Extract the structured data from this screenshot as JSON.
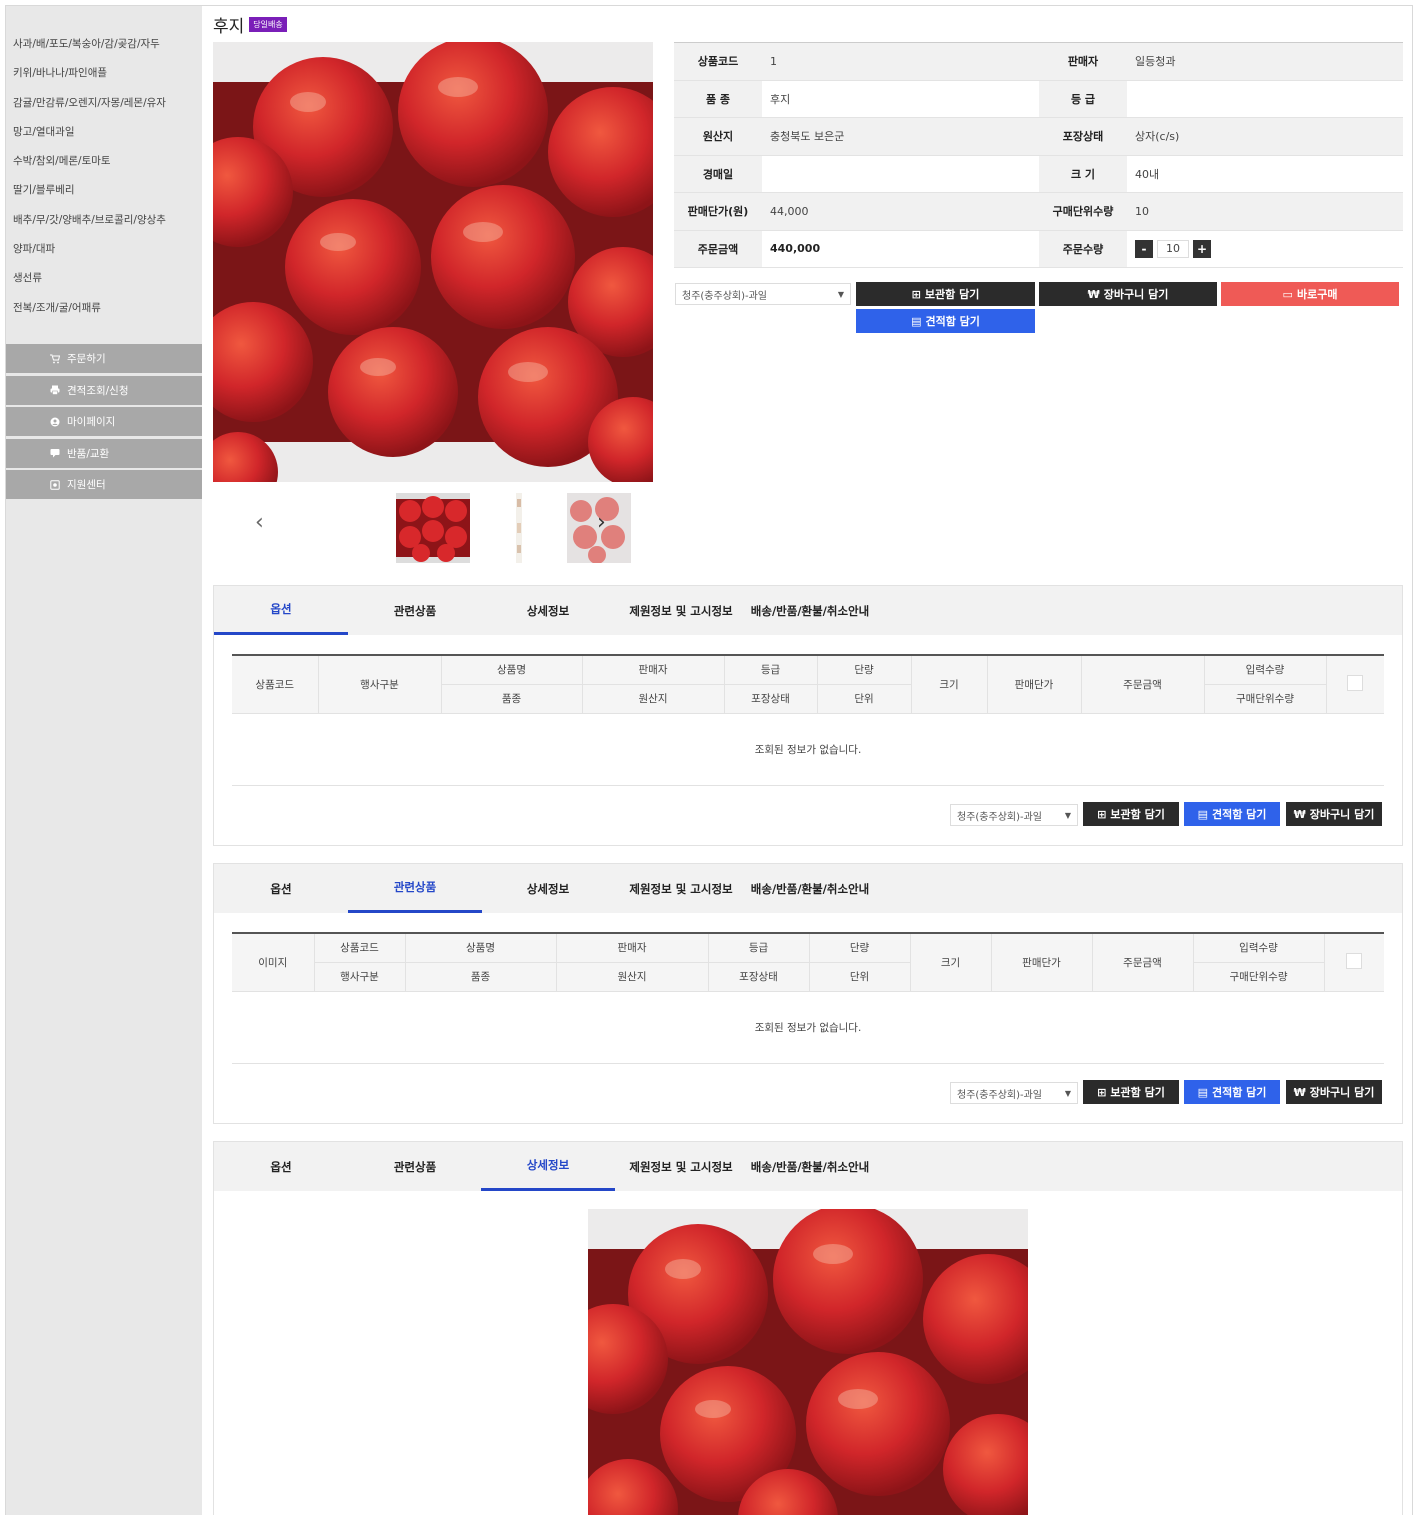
{
  "sidebar": {
    "categories": [
      "사과/배/포도/복숭아/감/곶감/자두",
      "키위/바나나/파인애플",
      "감귤/만감류/오렌지/자몽/레몬/유자",
      "망고/열대과일",
      "수박/참외/메론/토마토",
      "딸기/블루베리",
      "배추/무/갓/양배추/브로콜리/양상추",
      "양파/대파",
      "생선류",
      "전복/조개/굴/어패류"
    ],
    "menu": [
      {
        "label": "주문하기",
        "icon": "cart-icon"
      },
      {
        "label": "견적조회/신청",
        "icon": "print-icon"
      },
      {
        "label": "마이페이지",
        "icon": "user-icon"
      },
      {
        "label": "반품/교환",
        "icon": "chat-icon"
      },
      {
        "label": "지원센터",
        "icon": "support-icon"
      }
    ]
  },
  "product": {
    "title": "후지",
    "badge": "당일배송",
    "labels": {
      "code": "상품코드",
      "seller": "판매자",
      "variety": "품 종",
      "grade": "등 급",
      "origin": "원산지",
      "packaging": "포장상태",
      "auction_date": "경매일",
      "size": "크 기",
      "unit_price": "판매단가(원)",
      "unit_qty": "구매단위수량",
      "order_amount": "주문금액",
      "order_qty": "주문수량"
    },
    "values": {
      "code": "1",
      "seller": "일등청과",
      "variety": "후지",
      "grade": "",
      "origin": "충청북도 보은군",
      "packaging": "상자(c/s)",
      "auction_date": "",
      "size": "40내",
      "unit_price": "44,000",
      "unit_qty": "10",
      "order_amount": "440,000",
      "order_qty": "10"
    },
    "qty_minus": "-",
    "qty_plus": "+"
  },
  "actions": {
    "market_select": "청주(충주상회)-과일",
    "storage": "보관함 담기",
    "cart": "장바구니 담기",
    "buy_now": "바로구매",
    "estimate": "견적함 담기"
  },
  "tabs": [
    "옵션",
    "관련상품",
    "상세정보",
    "제원정보 및 고시정보",
    "배송/반품/환불/취소안내"
  ],
  "option_table": {
    "top": [
      "상품명",
      "판매자",
      "등급",
      "단량",
      "입력수량"
    ],
    "bottom": [
      "품종",
      "원산지",
      "포장상태",
      "단위",
      "구매단위수량"
    ],
    "span": [
      "상품코드",
      "행사구분",
      "크기",
      "판매단가",
      "주문금액"
    ],
    "empty": "조회된 정보가 없습니다."
  },
  "related_table": {
    "image": "이미지",
    "top": [
      "상품코드",
      "상품명",
      "판매자",
      "등급",
      "단량",
      "입력수량"
    ],
    "bottom": [
      "행사구분",
      "품종",
      "원산지",
      "포장상태",
      "단위",
      "구매단위수량"
    ],
    "span": [
      "크기",
      "판매단가",
      "주문금액"
    ],
    "empty": "조회된 정보가 없습니다."
  },
  "colors": {
    "accent_blue": "#2447c8",
    "button_dark": "#2b2b2b",
    "button_blue": "#2f62ea",
    "button_red": "#ef5a56",
    "badge_purple": "#7a1fb8",
    "price_red": "#e8433f"
  }
}
